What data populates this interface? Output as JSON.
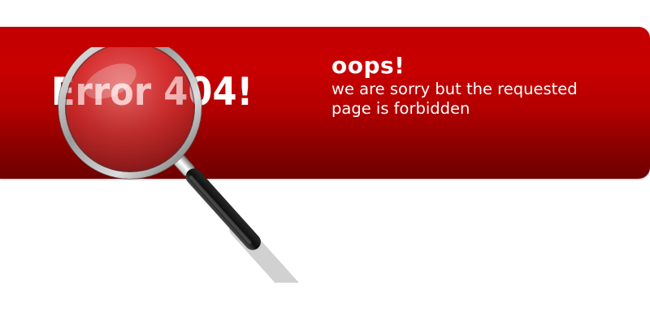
{
  "error_panel": {
    "title": "Error 404!",
    "heading": "oops!",
    "message": "we are sorry but the requested page is forbidden"
  },
  "icons": {
    "magnifier": "magnifying-glass-icon"
  },
  "colors": {
    "banner_top": "#c80000",
    "banner_bottom": "#6e0000",
    "text": "#ffffff",
    "page_background": "#ffffff"
  }
}
